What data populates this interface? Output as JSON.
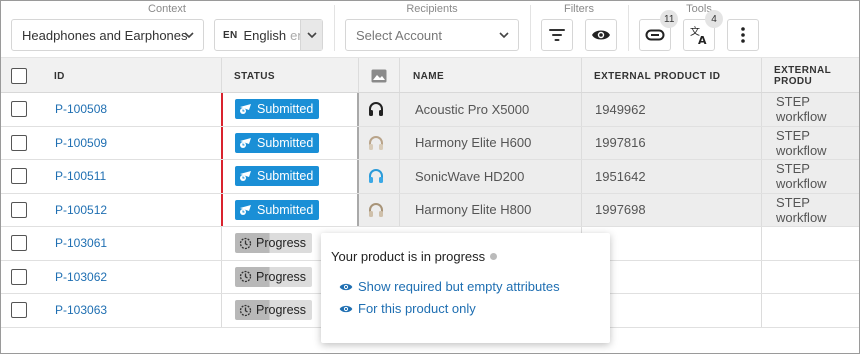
{
  "toolbar": {
    "context_label": "Context",
    "context_value": "Headphones and Earphones",
    "lang_code": "EN",
    "lang_name": "English",
    "lang_sub": "en",
    "recipients_label": "Recipients",
    "recipients_placeholder": "Select Account",
    "filters_label": "Filters",
    "tools_label": "Tools",
    "badge_1": "11",
    "badge_2": "4"
  },
  "grid": {
    "headers": {
      "id": "ID",
      "status": "STATUS",
      "name": "NAME",
      "external_id": "EXTERNAL PRODUCT ID",
      "external_wf": "EXTERNAL PRODU"
    },
    "rows": [
      {
        "id": "P-100508",
        "status": "Submitted",
        "name": "Acoustic Pro X5000",
        "ext_id": "1949962",
        "wf": "STEP workflow"
      },
      {
        "id": "P-100509",
        "status": "Submitted",
        "name": "Harmony Elite H600",
        "ext_id": "1997816",
        "wf": "STEP workflow"
      },
      {
        "id": "P-100511",
        "status": "Submitted",
        "name": "SonicWave HD200",
        "ext_id": "1951642",
        "wf": "STEP workflow"
      },
      {
        "id": "P-100512",
        "status": "Submitted",
        "name": "Harmony Elite H800",
        "ext_id": "1997698",
        "wf": "STEP workflow"
      },
      {
        "id": "P-103061",
        "status": "Progress",
        "name": "",
        "ext_id": "",
        "wf": ""
      },
      {
        "id": "P-103062",
        "status": "Progress",
        "name": "",
        "ext_id": "",
        "wf": ""
      },
      {
        "id": "P-103063",
        "status": "Progress",
        "name": "",
        "ext_id": "",
        "wf": ""
      }
    ]
  },
  "popover": {
    "title": "Your product is in progress",
    "link_1": "Show required but empty attributes",
    "link_2": "For this product only"
  },
  "colors": {
    "submitted": "#1a8fd6",
    "link": "#1f6fb2",
    "warning_bar": "#d9232e"
  }
}
